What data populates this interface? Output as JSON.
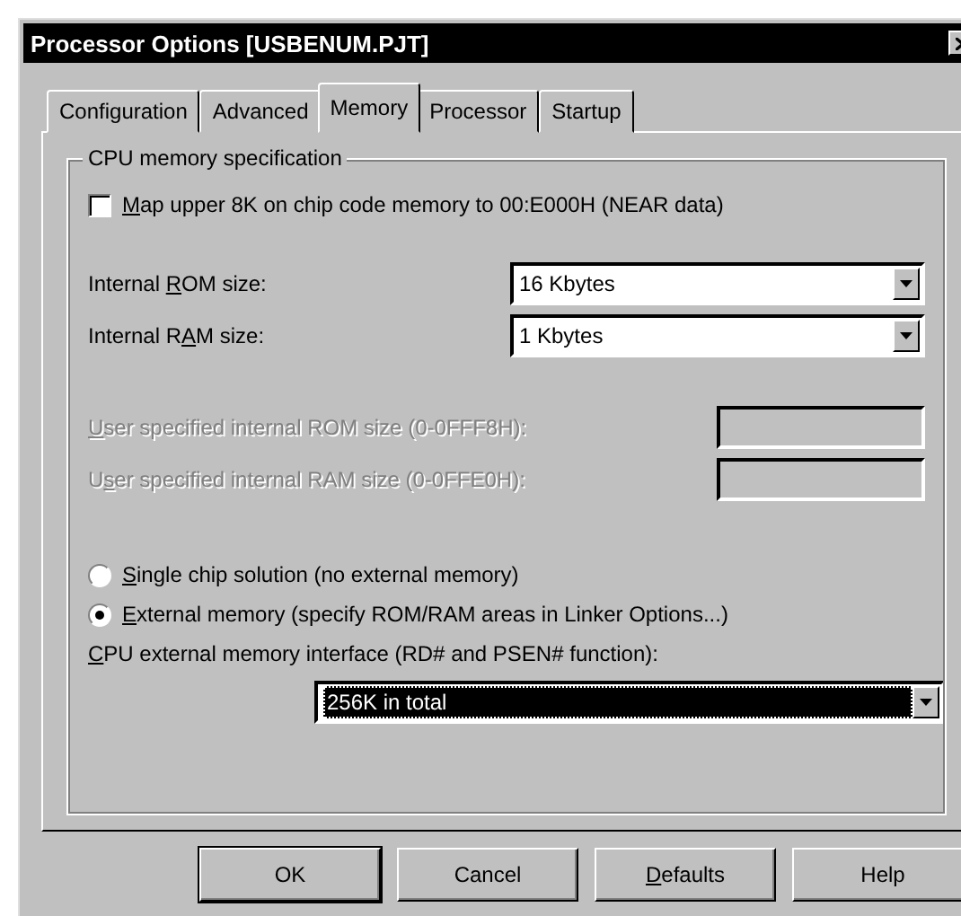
{
  "window": {
    "title": "Processor Options [USBENUM.PJT]"
  },
  "tabs": [
    {
      "label": "Configuration",
      "selected": false
    },
    {
      "label": "Advanced",
      "selected": false
    },
    {
      "label": "Memory",
      "selected": true
    },
    {
      "label": "Processor",
      "selected": false
    },
    {
      "label": "Startup",
      "selected": false
    }
  ],
  "group": {
    "title": "CPU memory specification",
    "checkbox": {
      "label": {
        "key": "M",
        "after": "ap upper 8K on chip code memory to 00:E000H (NEAR data)"
      },
      "checked": false
    },
    "size_combos": [
      {
        "label": {
          "before": "Internal ",
          "key": "R",
          "after": "OM size:"
        },
        "value": "16 Kbytes"
      },
      {
        "label": {
          "before": "Internal R",
          "key": "A",
          "after": "M size:"
        },
        "value": "1 Kbytes"
      }
    ],
    "user_fields": [
      {
        "label": {
          "key": "U",
          "after": "ser specified internal ROM size (0-0FFF8H):"
        },
        "disabled": true
      },
      {
        "label": {
          "before": "U",
          "key": "s",
          "after": "er specified internal RAM size (0-0FFE0H):"
        },
        "disabled": true
      }
    ],
    "radios": [
      {
        "label": {
          "key": "S",
          "after": "ingle chip solution (no external memory)"
        },
        "selected": false
      },
      {
        "label": {
          "key": "E",
          "after": "xternal memory (specify ROM/RAM areas in Linker Options...)"
        },
        "selected": true
      }
    ],
    "interface": {
      "label": {
        "key": "C",
        "after": "PU external memory interface (RD# and PSEN# function):"
      },
      "value": "256K in total",
      "focused": true
    }
  },
  "buttons": [
    {
      "label": {
        "after": "OK"
      },
      "default": true
    },
    {
      "label": {
        "after": "Cancel"
      },
      "default": false
    },
    {
      "label": {
        "key": "D",
        "after": "efaults"
      },
      "default": false
    },
    {
      "label": {
        "after": "Help"
      },
      "default": false
    }
  ]
}
